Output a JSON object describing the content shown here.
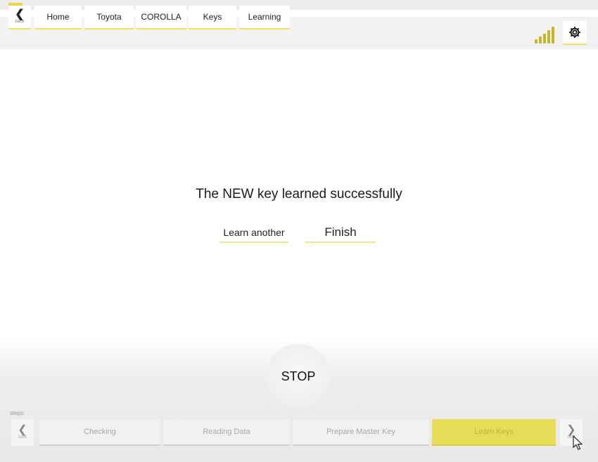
{
  "header": {
    "back_label": "back",
    "breadcrumbs": [
      "Home",
      "Toyota",
      "COROLLA",
      "Keys",
      "Learning"
    ],
    "signal_icon": "signal-bars-icon",
    "settings_icon": "gear-icon",
    "accent_color": "#eee26a"
  },
  "main": {
    "message": "The NEW key learned successfully",
    "learn_another_label": "Learn another",
    "finish_label": "Finish"
  },
  "footer": {
    "stop_label": "STOP",
    "steps_label": "steps:",
    "prev_label": "back",
    "next_label": "next",
    "steps": [
      "Checking",
      "Reading Data",
      "Prepare Master Key",
      "Learn Keys"
    ],
    "active_step": "Learn Keys",
    "active_color": "#e6dc58"
  }
}
